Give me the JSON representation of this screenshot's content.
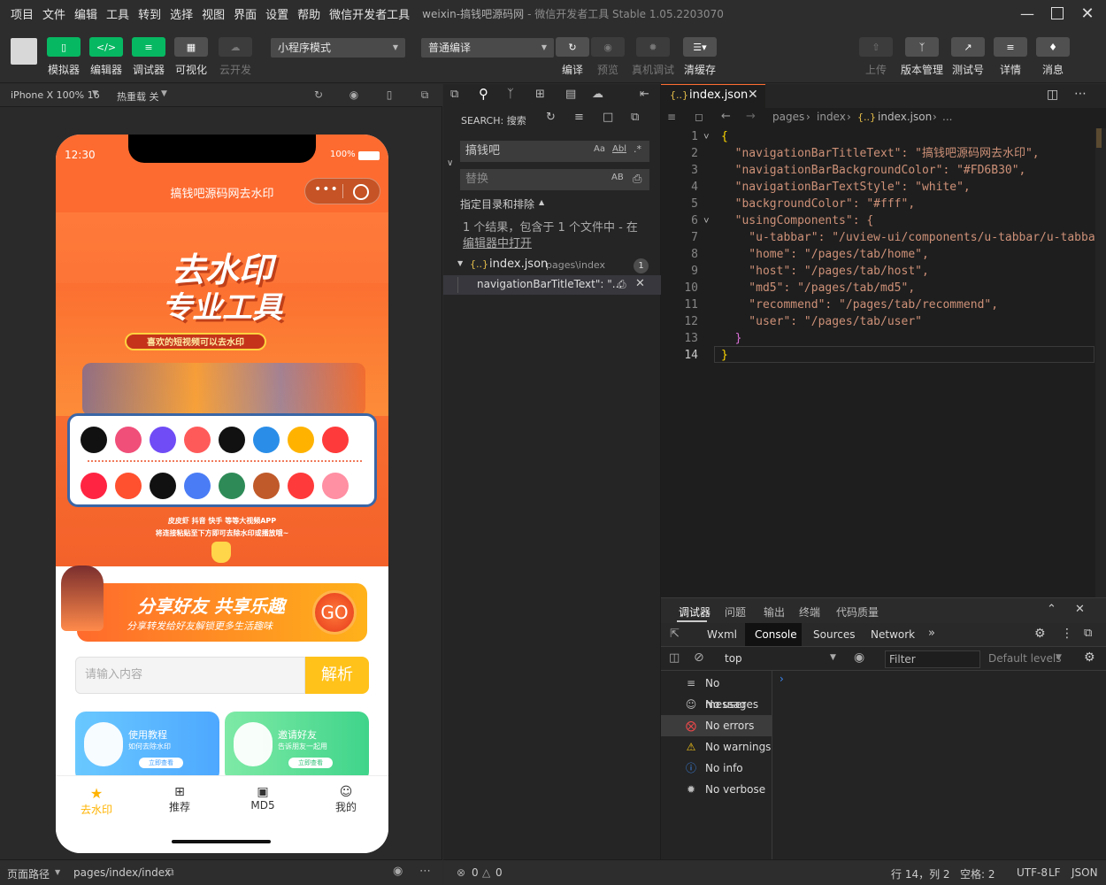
{
  "menu": [
    "项目",
    "文件",
    "编辑",
    "工具",
    "转到",
    "选择",
    "视图",
    "界面",
    "设置",
    "帮助",
    "微信开发者工具"
  ],
  "window_title": "weixin-搞钱吧源码网",
  "window_subtitle": "- 微信开发者工具 Stable 1.05.2203070",
  "toolbar": {
    "simulator": "模拟器",
    "editor": "编辑器",
    "debugger": "调试器",
    "visual": "可视化",
    "cloud": "云开发",
    "mode_select": "小程序模式",
    "compile_select": "普通编译",
    "compile": "编译",
    "preview": "预览",
    "real_debug": "真机调试",
    "clear_cache": "清缓存",
    "upload": "上传",
    "version": "版本管理",
    "test": "测试号",
    "details": "详情",
    "messages": "消息"
  },
  "simbar": {
    "device": "iPhone X 100% 16",
    "hotreload": "热重载 关"
  },
  "phone": {
    "time": "12:30",
    "battery": "100%",
    "nav_title": "搞钱吧源码网去水印",
    "banner_title1": "去水印",
    "banner_title2": "专业工具",
    "banner_sub": "喜欢的短视频可以去水印",
    "platform_line": "皮皮虾 抖音 快手 等等大视频APP",
    "tip_line": "将连接粘贴至下方即可去除水印或播放哦~",
    "share_title": "分享好友 共享乐趣",
    "share_sub": "分享转发给好友解锁更多生活趣味",
    "go": "GO",
    "input_placeholder": "请输入内容",
    "parse_button": "解析",
    "card1_title": "使用教程",
    "card1_sub": "如何去除水印",
    "card1_btn": "立即查看",
    "card2_title": "邀请好友",
    "card2_sub": "告诉朋友一起用",
    "card2_btn": "立即查看",
    "tabs": [
      "去水印",
      "推荐",
      "MD5",
      "我的"
    ]
  },
  "simfoot": {
    "path_label": "页面路径",
    "path": "pages/index/index"
  },
  "search": {
    "header": "SEARCH: 搜索",
    "query": "搞钱吧",
    "case_toggle": "Aa",
    "word_toggle": "Abl",
    "regex_toggle": ".*",
    "replace_placeholder": "替换",
    "replace_toggle": "AB",
    "include_label": "指定目录和排除",
    "result_summary1": "1 个结果，包含于 1 个文件中 - 在",
    "result_summary2": "编辑器中打开",
    "file_icon": "{..}",
    "file_name": "index.json",
    "file_path": "pages\\index",
    "file_count": "1",
    "match_text": "navigationBarTitleText\": \"..."
  },
  "editor": {
    "tab_icon": "{..}",
    "tab_label": "index.json",
    "breadcrumb": [
      "pages",
      "index",
      "index.json",
      "..."
    ],
    "lines": [
      {
        "n": "1",
        "t": "{"
      },
      {
        "n": "2",
        "t": "  \"navigationBarTitleText\": \"搞钱吧源码网去水印\","
      },
      {
        "n": "3",
        "t": "  \"navigationBarBackgroundColor\": \"#FD6B30\","
      },
      {
        "n": "4",
        "t": "  \"navigationBarTextStyle\": \"white\","
      },
      {
        "n": "5",
        "t": "  \"backgroundColor\": \"#fff\","
      },
      {
        "n": "6",
        "t": "  \"usingComponents\": {"
      },
      {
        "n": "7",
        "t": "    \"u-tabbar\": \"/uview-ui/components/u-tabbar/u-tabbar\","
      },
      {
        "n": "8",
        "t": "    \"home\": \"/pages/tab/home\","
      },
      {
        "n": "9",
        "t": "    \"host\": \"/pages/tab/host\","
      },
      {
        "n": "10",
        "t": "    \"md5\": \"/pages/tab/md5\","
      },
      {
        "n": "11",
        "t": "    \"recommend\": \"/pages/tab/recommend\","
      },
      {
        "n": "12",
        "t": "    \"user\": \"/pages/tab/user\""
      },
      {
        "n": "13",
        "t": "  }"
      },
      {
        "n": "14",
        "t": "}"
      }
    ]
  },
  "devtools": {
    "tabs": [
      "调试器",
      "问题",
      "输出",
      "终端",
      "代码质量"
    ],
    "subtabs": [
      "Wxml",
      "Console",
      "Sources",
      "Network"
    ],
    "context": "top",
    "filter_placeholder": "Filter",
    "levels": "Default levels",
    "side": [
      "No messages",
      "No user me...",
      "No errors",
      "No warnings",
      "No info",
      "No verbose"
    ]
  },
  "status": {
    "problems": "0",
    "warnings": "0",
    "position": "行 14，列 2",
    "spaces": "空格: 2",
    "encoding": "UTF-8",
    "eol": "LF",
    "lang": "JSON"
  },
  "colors": {
    "accent": "#07b862",
    "nav": "#FD6B30"
  }
}
